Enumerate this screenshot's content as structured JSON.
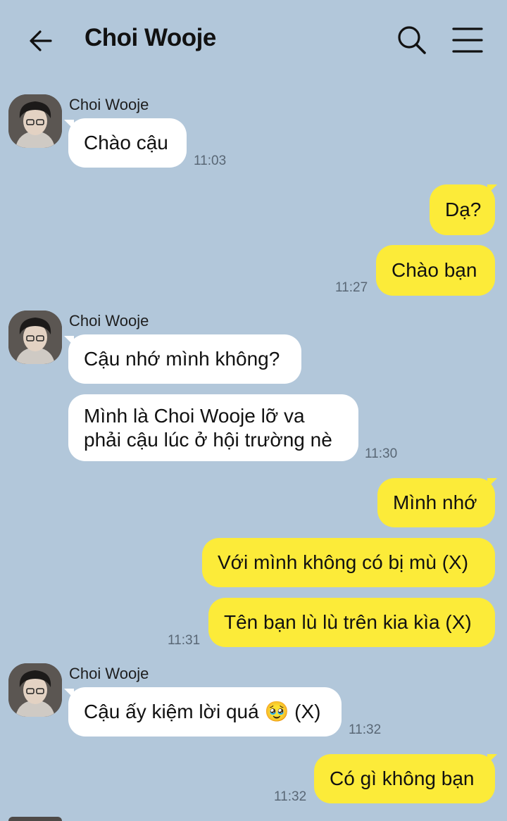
{
  "header": {
    "title": "Choi Wooje",
    "back_icon": "arrow-left-icon",
    "search_icon": "search-icon",
    "menu_icon": "hamburger-menu-icon"
  },
  "colors": {
    "background": "#b2c7da",
    "incoming_bubble": "#ffffff",
    "outgoing_bubble": "#fceb39",
    "timestamp": "#596775"
  },
  "messages": [
    {
      "sender": "Choi Wooje",
      "direction": "in",
      "text": "Chào cậu",
      "time": "11:03"
    },
    {
      "direction": "out",
      "text": "Dạ?"
    },
    {
      "direction": "out",
      "text": "Chào bạn",
      "time": "11:27"
    },
    {
      "sender": "Choi Wooje",
      "direction": "in",
      "text": "Cậu nhớ mình không?"
    },
    {
      "direction": "in",
      "lines": [
        "Mình là Choi Wooje lỡ va",
        "phải cậu lúc ở hội trường nè"
      ],
      "time": "11:30"
    },
    {
      "direction": "out",
      "text": "Mình nhớ"
    },
    {
      "direction": "out",
      "text": "Với mình không có bị mù (X)"
    },
    {
      "direction": "out",
      "text": "Tên bạn lù lù trên kia kìa (X)",
      "time": "11:31"
    },
    {
      "sender": "Choi Wooje",
      "direction": "in",
      "text": "Cậu ấy kiệm lời quá 🥹 (X)",
      "time": "11:32"
    },
    {
      "direction": "out",
      "text": "Có gì không bạn",
      "time": "11:32"
    }
  ]
}
